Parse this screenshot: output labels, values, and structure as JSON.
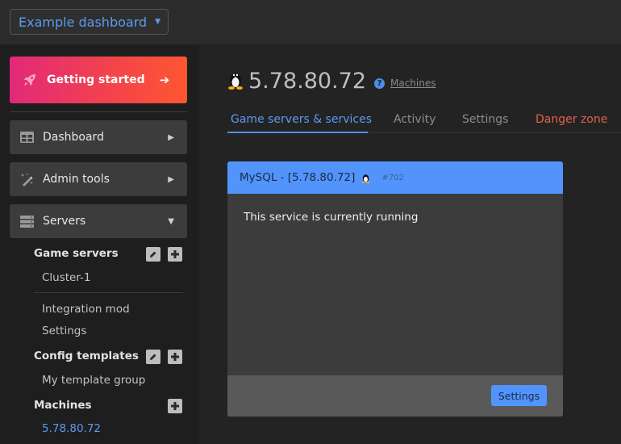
{
  "topbar": {
    "dashboard_select": {
      "value": "Example dashboard",
      "icon": "caret-down-icon"
    }
  },
  "sidebar": {
    "getting_started": {
      "label": "Getting started",
      "icon": "rocket-icon",
      "arrow_icon": "arrow-right-icon"
    },
    "nav": [
      {
        "label": "Dashboard",
        "icon": "grid-icon",
        "state": "collapsed"
      },
      {
        "label": "Admin tools",
        "icon": "magic-wand-icon",
        "state": "collapsed"
      },
      {
        "label": "Servers",
        "icon": "server-icon",
        "state": "expanded"
      }
    ],
    "sections": {
      "game_servers": {
        "label": "Game servers",
        "items": [
          "Cluster-1"
        ]
      },
      "extra_items": [
        "Integration mod",
        "Settings"
      ],
      "config_templates": {
        "label": "Config templates",
        "items": [
          "My template group"
        ]
      },
      "machines": {
        "label": "Machines",
        "items": [
          "5.78.80.72"
        ]
      }
    }
  },
  "main": {
    "title": "5.78.80.72",
    "os_icon": "linux-tux-icon",
    "breadcrumb_link": "Machines",
    "tabs": [
      {
        "label": "Game servers & services",
        "active": true
      },
      {
        "label": "Activity"
      },
      {
        "label": "Settings"
      },
      {
        "label": "Danger zone",
        "variant": "danger"
      }
    ],
    "service_card": {
      "title": "MySQL - [5.78.80.72]",
      "id": "#702",
      "status_text": "This service is currently running",
      "button_label": "Settings"
    }
  },
  "colors": {
    "accent": "#5294fb",
    "danger": "#e5604a",
    "gradient_start": "#e2297a",
    "gradient_end": "#ff5630"
  }
}
